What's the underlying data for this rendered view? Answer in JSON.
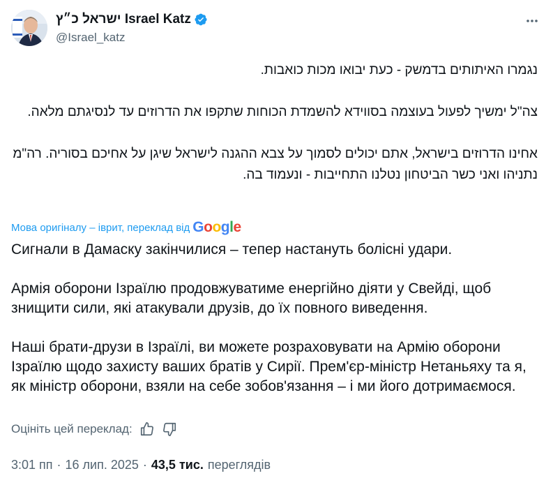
{
  "author": {
    "display_name": "ישראל כ״ץ Israel Katz",
    "handle": "@Israel_katz",
    "verified_color": "#1d9bf0"
  },
  "icons": {
    "avatar": "avatar-photo",
    "verified": "verified-badge-icon",
    "more": "more-horizontal-icon",
    "thumbs_up": "thumbs-up-icon",
    "thumbs_down": "thumbs-down-icon"
  },
  "original_text": "נגמרו האיתותים בדמשק - כעת יבואו מכות כואבות.\n\nצה\"ל ימשיך לפעול בעוצמה בסווידא להשמדת הכוחות שתקפו את הדרוזים עד לנסיגתם מלאה.\n\nאחינו הדרוזים בישראל, אתם יכולים לסמוך על צבא ההגנה לישראל שיגן על אחיכם בסוריה. רה\"מ נתניהו ואני כשר הביטחון נטלנו התחייבות - ונעמוד בה.",
  "translation_label": "Мова оригіналу – іврит, переклад від",
  "translation_provider": "Google",
  "translation_text": "Сигнали в Дамаску закінчилися – тепер настануть болісні удари.\n\nАрмія оборони Ізраїлю продовжуватиме енергійно діяти у Свейді, щоб знищити сили, які атакували друзів, до їх повного виведення.\n\nНаші брати-друзи в Ізраїлі, ви можете розраховувати на Армію оборони Ізраїлю щодо захисту ваших братів у Сирії. Прем'єр-міністр Нетаньяху та я, як міністр оборони, взяли на себе зобов'язання – і ми його дотримаємося.",
  "rate_label": "Оцініть цей переклад:",
  "meta": {
    "time": "3:01 пп",
    "separator": "·",
    "date": "16 лип. 2025",
    "views_count": "43,5 тис.",
    "views_label": "переглядів"
  }
}
